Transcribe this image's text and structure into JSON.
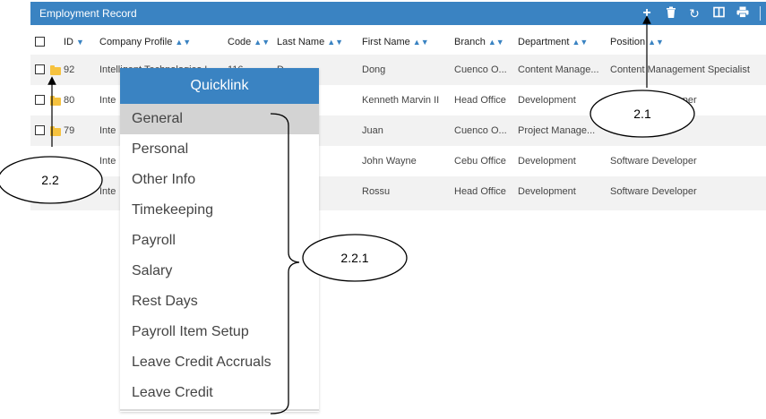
{
  "header": {
    "title": "Employment Record",
    "add_icon": "plus-icon",
    "delete_icon": "trash-icon",
    "refresh_icon": "refresh-icon",
    "columns_icon": "columns-icon",
    "print_icon": "print-icon"
  },
  "columns": [
    "ID",
    "Company Profile",
    "Code",
    "Last Name",
    "First Name",
    "Branch",
    "Department",
    "Position"
  ],
  "rows": [
    {
      "id": "92",
      "company": "Intelligent Technologies I",
      "code": "116",
      "last": "D",
      "first": "Dong",
      "branch": "Cuenco O...",
      "department": "Content Manage...",
      "position": "Content Management Specialist"
    },
    {
      "id": "80",
      "company": "Inte",
      "code": "",
      "last": "",
      "first": "Kenneth Marvin II",
      "branch": "Head Office",
      "department": "Development",
      "position": "Software Developer"
    },
    {
      "id": "79",
      "company": "Inte",
      "code": "",
      "last": "",
      "first": "Juan",
      "branch": "Cuenco O...",
      "department": "Project Manage...",
      "position": ""
    },
    {
      "id": "",
      "company": "Inte",
      "code": "",
      "last": "",
      "first": "John Wayne",
      "branch": "Cebu Office",
      "department": "Development",
      "position": "Software Developer"
    },
    {
      "id": "",
      "company": "Inte",
      "code": "",
      "last": "",
      "first": "Rossu",
      "branch": "Head Office",
      "department": "Development",
      "position": "Software Developer"
    }
  ],
  "quicklink": {
    "title": "Quicklink",
    "items": [
      "General",
      "Personal",
      "Other Info",
      "Timekeeping",
      "Payroll",
      "Salary",
      "Rest Days",
      "Payroll Item Setup",
      "Leave Credit Accruals",
      "Leave Credit"
    ],
    "active": "General"
  },
  "annotations": {
    "a21": "2.1",
    "a22": "2.2",
    "a221": "2.2.1"
  },
  "colors": {
    "accent": "#3a83c2",
    "active_item": "#d3d3d3",
    "folder": "#f6c23e"
  }
}
